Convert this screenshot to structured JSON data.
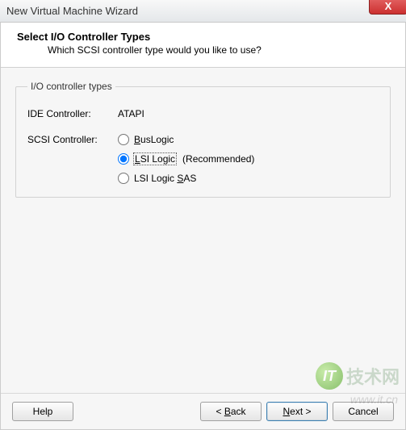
{
  "window": {
    "title": "New Virtual Machine Wizard",
    "close_label": "X"
  },
  "header": {
    "title": "Select I/O Controller Types",
    "subtitle": "Which SCSI controller type would you like to use?"
  },
  "group": {
    "legend": "I/O controller types",
    "ide_label": "IDE Controller:",
    "ide_value": "ATAPI",
    "scsi_label": "SCSI Controller:",
    "options": [
      {
        "pre": "",
        "u": "B",
        "post": "usLogic",
        "selected": false,
        "recommended": false
      },
      {
        "pre": "",
        "u": "L",
        "post": "SI Logic",
        "selected": true,
        "recommended": true
      },
      {
        "pre": "LSI Logic ",
        "u": "S",
        "post": "AS",
        "selected": false,
        "recommended": false
      }
    ],
    "recommended_text": "(Recommended)"
  },
  "footer": {
    "help": "Help",
    "back_pre": "< ",
    "back_u": "B",
    "back_post": "ack",
    "next_u": "N",
    "next_post": "ext >",
    "cancel": "Cancel"
  },
  "watermark": {
    "text": "技术网",
    "badge": "IT",
    "url": "www.it.cn"
  }
}
